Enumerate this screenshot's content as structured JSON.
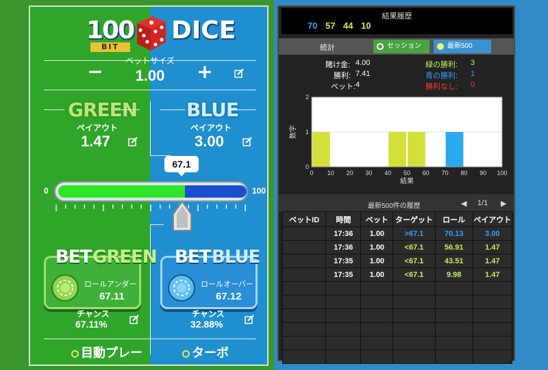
{
  "game": {
    "logo": {
      "number": "100",
      "badge": "BIT",
      "word": "DICE"
    },
    "bet_size": {
      "label": "ベットサイズ",
      "value": "1.00",
      "minus": "−",
      "plus": "+"
    },
    "green": {
      "title": "GREEN",
      "payout_label": "ペイアウト",
      "payout_value": "1.47"
    },
    "blue": {
      "title": "BLUE",
      "payout_label": "ペイアウト",
      "payout_value": "3.00"
    },
    "slider": {
      "min": "0",
      "max": "100",
      "value": "67.1",
      "fraction": 0.671
    },
    "bet_green": {
      "title_a": "BET",
      "title_b": "GREEN",
      "roll_label": "ロールアンダー",
      "roll_value": "67.11",
      "chance_label": "チャンス",
      "chance_value": "67.11%"
    },
    "bet_blue": {
      "title_a": "BET",
      "title_b": "BLUE",
      "roll_label": "ロールオーバー",
      "roll_value": "67.12",
      "chance_label": "チャンス",
      "chance_value": "32.88%"
    },
    "options": {
      "auto_play": "目動プレー",
      "turbo": "ターボ"
    }
  },
  "stats": {
    "history_title": "結果履歴",
    "history_numbers": [
      {
        "value": "70",
        "color": "#3aa0ff"
      },
      {
        "value": "57",
        "color": "#c8f05a"
      },
      {
        "value": "44",
        "color": "#c8f05a"
      },
      {
        "value": "10",
        "color": "#c8f05a"
      }
    ],
    "stats_label": "統計",
    "tab_session": "セッション",
    "tab_latest": "最新500",
    "bet_amount_label": "賭け金:",
    "bet_amount_value": "4.00",
    "profit_label": "勝利:",
    "profit_value": "7.41",
    "bets_label": "ベット:",
    "bets_value": "4",
    "green_wins_label": "緑の勝利:",
    "green_wins_value": "3",
    "blue_wins_label": "青の勝利:",
    "blue_wins_value": "1",
    "no_wins_label": "勝利なし:",
    "no_wins_value": "0",
    "table_caption": "最新500件の履歴",
    "page": "1/1",
    "columns": [
      "ベットID",
      "時間",
      "ベット",
      "ターゲット",
      "ロール",
      "ペイアウト"
    ],
    "rows": [
      {
        "id": "",
        "time": "17:36",
        "bet": "1.00",
        "target": ">67.1",
        "roll": "70.13",
        "payout": "3.00",
        "color": "#3aa0ff"
      },
      {
        "id": "",
        "time": "17:36",
        "bet": "1.00",
        "target": "<67.1",
        "roll": "56.91",
        "payout": "1.47",
        "color": "#c8f05a"
      },
      {
        "id": "",
        "time": "17:35",
        "bet": "1.00",
        "target": "<67.1",
        "roll": "43.51",
        "payout": "1.47",
        "color": "#c8f05a"
      },
      {
        "id": "",
        "time": "17:35",
        "bet": "1.00",
        "target": "<67.1",
        "roll": "9.98",
        "payout": "1.47",
        "color": "#c8f05a"
      }
    ],
    "empty_rows": 6
  },
  "chart_data": {
    "type": "bar",
    "xlabel": "結果",
    "ylabel": "数字",
    "xlim": [
      0,
      100
    ],
    "ylim": [
      0,
      2
    ],
    "xticks": [
      "0",
      "10",
      "20",
      "30",
      "40",
      "50",
      "60",
      "70",
      "80",
      "90",
      "100"
    ],
    "yticks": [
      "0",
      "1",
      "2"
    ],
    "bins": [
      {
        "from": 0,
        "to": 10,
        "value": 1,
        "color": "#d4e03a"
      },
      {
        "from": 40,
        "to": 50,
        "value": 1,
        "color": "#d4e03a"
      },
      {
        "from": 50,
        "to": 60,
        "value": 1,
        "color": "#d4e03a"
      },
      {
        "from": 70,
        "to": 80,
        "value": 1,
        "color": "#2aa8f0"
      }
    ]
  }
}
